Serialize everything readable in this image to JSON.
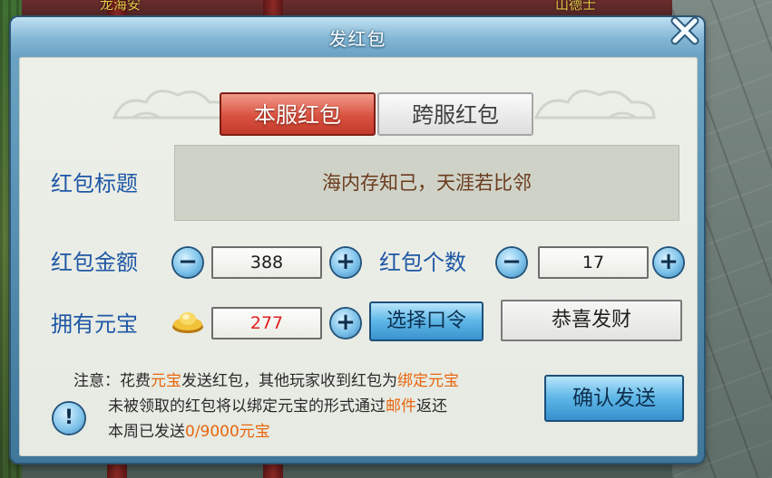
{
  "background": {
    "npc_name_left": "龙海安",
    "npc_name_right": "山德士"
  },
  "dialog": {
    "title": "发红包",
    "tabs": [
      {
        "label": "本服红包",
        "active": true
      },
      {
        "label": "跨服红包",
        "active": false
      }
    ],
    "title_label": "红包标题",
    "title_value": "海内存知己，天涯若比邻",
    "amount_label": "红包金额",
    "amount_value": "388",
    "count_label": "红包个数",
    "count_value": "17",
    "owned_label": "拥有元宝",
    "owned_value": "277",
    "select_button": "选择口令",
    "phrase_value": "恭喜发财",
    "confirm_button": "确认发送",
    "notice": {
      "line1_a": "注意：花费",
      "line1_b": "元宝",
      "line1_c": "发送红包，其他玩家收到红包为",
      "line1_d": "绑定元宝",
      "line2_a": "未被领取的红包将以绑定元宝的形式通过",
      "line2_b": "邮件",
      "line2_c": "返还",
      "line3_a": "本周已发送",
      "line3_b": "0/9000元宝"
    }
  },
  "colors": {
    "label_blue": "#1f57a6",
    "highlight_orange": "#e8650c",
    "active_tab_red": "#d9513f",
    "dialog_blue": "#3f7699"
  }
}
